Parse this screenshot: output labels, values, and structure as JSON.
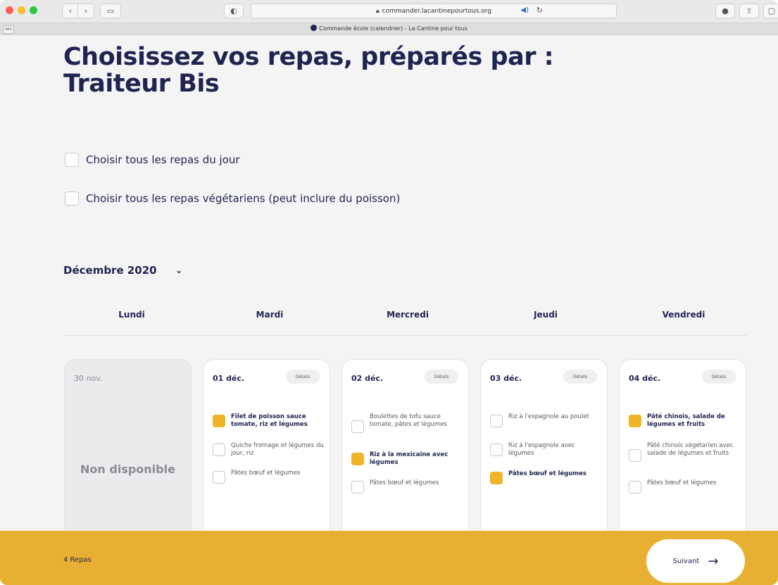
{
  "browser": {
    "url": "commander.lacantinepourtous.org",
    "tab_title": "Commande école (calendrier) - La Cantine pour tous",
    "small_tab_label": "WIX"
  },
  "page": {
    "title": "Choisissez vos repas, préparés par : Traiteur Bis",
    "option_all_day": "Choisir tous les repas du jour",
    "option_vegetarian": "Choisir tous les repas végétariens (peut inclure du poisson)",
    "month": "Décembre 2020"
  },
  "weekdays": [
    "Lundi",
    "Mardi",
    "Mercredi",
    "Jeudi",
    "Vendredi"
  ],
  "days": [
    {
      "date": "30 nov.",
      "unavailable": "Non disponible"
    },
    {
      "date": "01 déc.",
      "details": "Détails",
      "meals": [
        {
          "label": "Filet de poisson sauce tomate, riz et légumes",
          "selected": true
        },
        {
          "label": "Quiche fromage et légumes du jour, riz",
          "selected": false
        },
        {
          "label": "Pâtes bœuf et légumes",
          "selected": false
        }
      ]
    },
    {
      "date": "02 déc.",
      "details": "Détails",
      "meals": [
        {
          "label": "Boulettes de tofu sauce tomate, pâtes et légumes",
          "selected": false
        },
        {
          "label": "Riz à la mexicaine avec légumes",
          "selected": true
        },
        {
          "label": "Pâtes bœuf et légumes",
          "selected": false
        }
      ]
    },
    {
      "date": "03 déc.",
      "details": "Détails",
      "meals": [
        {
          "label": "Riz à l'espagnole au poulet",
          "selected": false
        },
        {
          "label": "Riz à l'espagnole avec légumes",
          "selected": false
        },
        {
          "label": "Pâtes bœuf et légumes",
          "selected": true
        }
      ]
    },
    {
      "date": "04 déc.",
      "details": "Détails",
      "meals": [
        {
          "label": "Pâté chinois, salade de légumes et fruits",
          "selected": true
        },
        {
          "label": "Pâté chinois végétarien avec salade de légumes et fruits",
          "selected": false
        },
        {
          "label": "Pâtes bœuf et légumes",
          "selected": false
        }
      ]
    }
  ],
  "footer": {
    "count": "4 Repas",
    "next_label": "Suivant"
  },
  "colors": {
    "accent": "#e8b033",
    "checked": "#f0b429",
    "text": "#1f2451"
  }
}
